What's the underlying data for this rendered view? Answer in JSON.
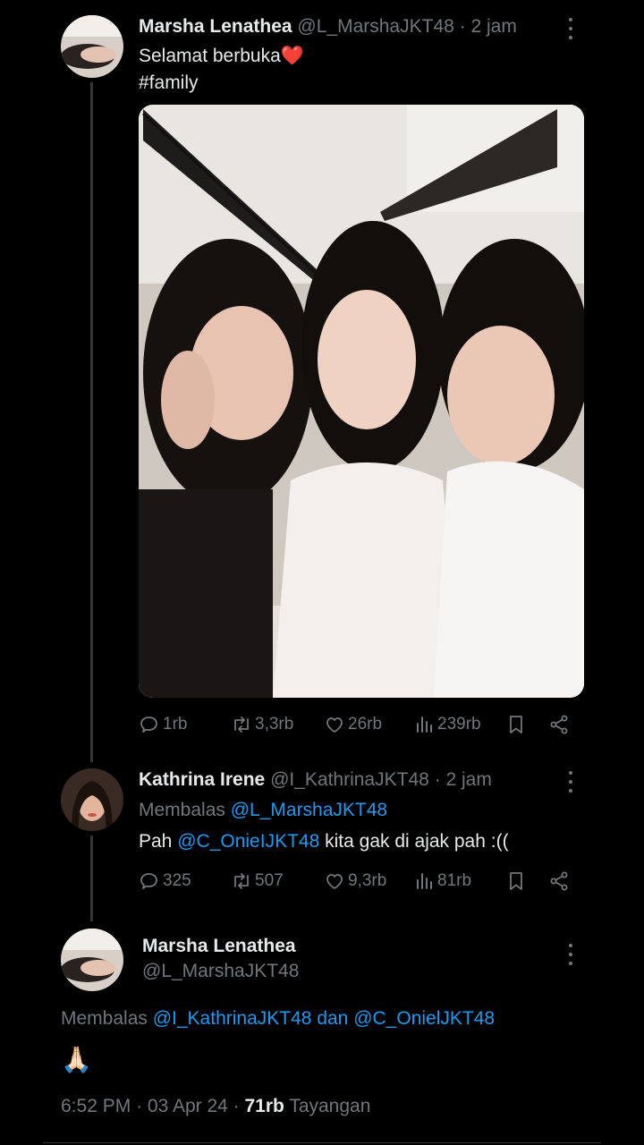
{
  "tweet1": {
    "name": "Marsha Lenathea",
    "handle": "@L_MarshaJKT48",
    "dot": "·",
    "time": "2 jam",
    "text": "Selamat berbuka",
    "emoji": "❤️",
    "hashtag": "#family",
    "actions": {
      "replies": "1rb",
      "retweets": "3,3rb",
      "likes": "26rb",
      "views": "239rb"
    }
  },
  "tweet2": {
    "name": "Kathrina Irene",
    "handle": "@I_KathrinaJKT48",
    "dot": "·",
    "time": "2 jam",
    "reply_prefix": "Membalas",
    "reply_to": "@L_MarshaJKT48",
    "text_before": "Pah",
    "mention": "@C_OnieIJKT48",
    "text_after": "kita gak di ajak pah :((",
    "actions": {
      "replies": "325",
      "retweets": "507",
      "likes": "9,3rb",
      "views": "81rb"
    }
  },
  "tweet3": {
    "name": "Marsha Lenathea",
    "handle": "@L_MarshaJKT48",
    "reply_prefix": "Membalas",
    "reply_to_1": "@I_KathrinaJKT48",
    "reply_joiner": "dan",
    "reply_to_2": "@C_OnielJKT48",
    "text": "🙏🏻",
    "meta_time": "6:52 PM",
    "meta_dot": "·",
    "meta_date": "03 Apr 24",
    "meta_dot2": "·",
    "views_count": "71rb",
    "views_label": "Tayangan"
  },
  "icons": [
    "reply-icon",
    "retweet-icon",
    "like-icon",
    "views-icon",
    "bookmark-icon",
    "share-icon",
    "more-icon"
  ],
  "colors": {
    "background": "#000000",
    "text": "#e7e9ea",
    "muted": "#71767b",
    "link": "#1d9bf0",
    "heart": "#f4212e"
  }
}
